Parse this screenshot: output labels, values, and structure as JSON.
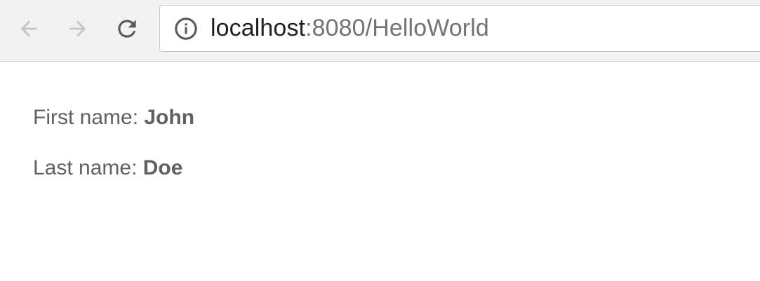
{
  "browser": {
    "url_host": "localhost",
    "url_rest": ":8080/HelloWorld",
    "icons": {
      "back": "arrow-left-icon",
      "forward": "arrow-right-icon",
      "reload": "reload-icon",
      "info": "info-icon"
    },
    "colors": {
      "toolbar_bg": "#f2f2f2",
      "disabled_icon": "#c4c4c4",
      "active_icon": "#5a5a5a"
    }
  },
  "page": {
    "first_name_label": "First name:",
    "first_name_value": "John",
    "last_name_label": "Last name:",
    "last_name_value": "Doe",
    "text_color": "#616161"
  }
}
